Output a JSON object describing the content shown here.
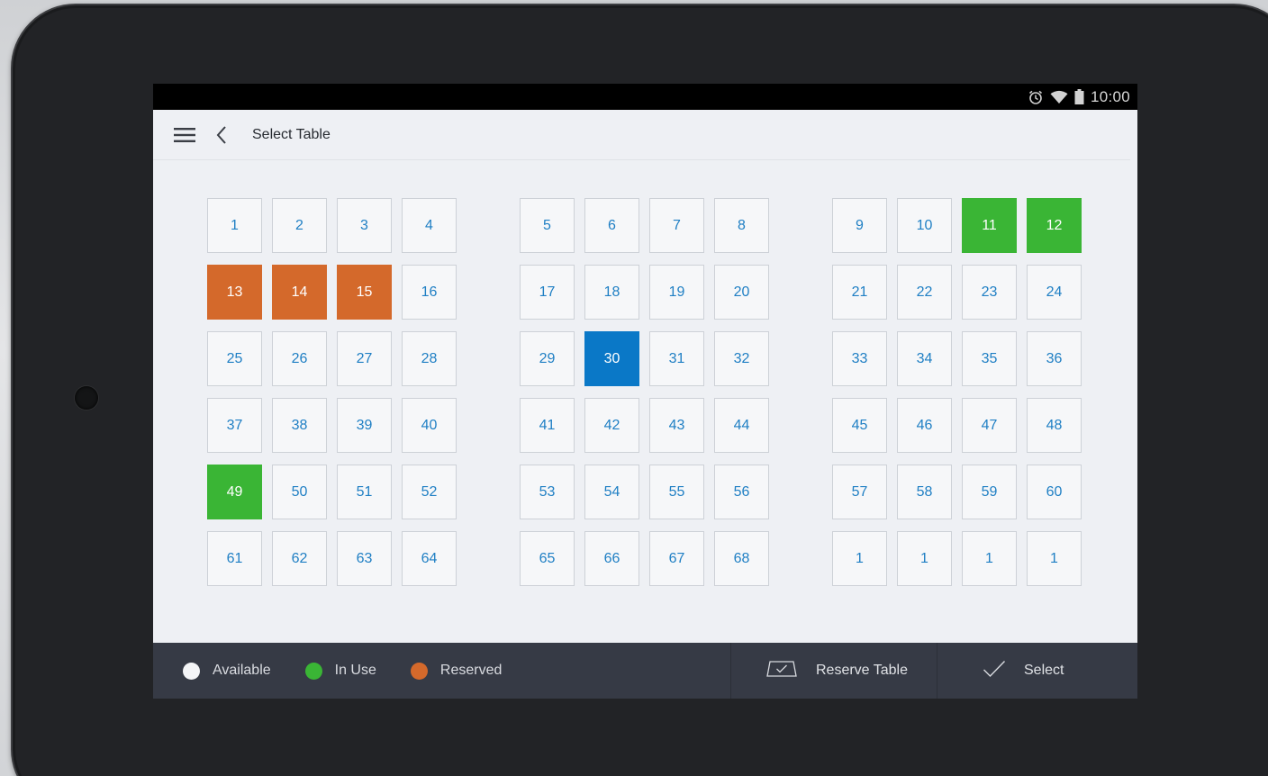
{
  "status_bar": {
    "time": "10:00",
    "icons": [
      "alarm-icon",
      "wifi-icon",
      "battery-icon"
    ]
  },
  "toolbar": {
    "title": "Select Table",
    "menu_icon": "hamburger-menu-icon",
    "back_icon": "chevron-left-icon"
  },
  "tables": {
    "groups": [
      [
        {
          "label": "1",
          "status": "available"
        },
        {
          "label": "2",
          "status": "available"
        },
        {
          "label": "3",
          "status": "available"
        },
        {
          "label": "4",
          "status": "available"
        },
        {
          "label": "13",
          "status": "reserved"
        },
        {
          "label": "14",
          "status": "reserved"
        },
        {
          "label": "15",
          "status": "reserved"
        },
        {
          "label": "16",
          "status": "available"
        },
        {
          "label": "25",
          "status": "available"
        },
        {
          "label": "26",
          "status": "available"
        },
        {
          "label": "27",
          "status": "available"
        },
        {
          "label": "28",
          "status": "available"
        },
        {
          "label": "37",
          "status": "available"
        },
        {
          "label": "38",
          "status": "available"
        },
        {
          "label": "39",
          "status": "available"
        },
        {
          "label": "40",
          "status": "available"
        },
        {
          "label": "49",
          "status": "inuse"
        },
        {
          "label": "50",
          "status": "available"
        },
        {
          "label": "51",
          "status": "available"
        },
        {
          "label": "52",
          "status": "available"
        },
        {
          "label": "61",
          "status": "available"
        },
        {
          "label": "62",
          "status": "available"
        },
        {
          "label": "63",
          "status": "available"
        },
        {
          "label": "64",
          "status": "available"
        }
      ],
      [
        {
          "label": "5",
          "status": "available"
        },
        {
          "label": "6",
          "status": "available"
        },
        {
          "label": "7",
          "status": "available"
        },
        {
          "label": "8",
          "status": "available"
        },
        {
          "label": "17",
          "status": "available"
        },
        {
          "label": "18",
          "status": "available"
        },
        {
          "label": "19",
          "status": "available"
        },
        {
          "label": "20",
          "status": "available"
        },
        {
          "label": "29",
          "status": "available"
        },
        {
          "label": "30",
          "status": "selected"
        },
        {
          "label": "31",
          "status": "available"
        },
        {
          "label": "32",
          "status": "available"
        },
        {
          "label": "41",
          "status": "available"
        },
        {
          "label": "42",
          "status": "available"
        },
        {
          "label": "43",
          "status": "available"
        },
        {
          "label": "44",
          "status": "available"
        },
        {
          "label": "53",
          "status": "available"
        },
        {
          "label": "54",
          "status": "available"
        },
        {
          "label": "55",
          "status": "available"
        },
        {
          "label": "56",
          "status": "available"
        },
        {
          "label": "65",
          "status": "available"
        },
        {
          "label": "66",
          "status": "available"
        },
        {
          "label": "67",
          "status": "available"
        },
        {
          "label": "68",
          "status": "available"
        }
      ],
      [
        {
          "label": "9",
          "status": "available"
        },
        {
          "label": "10",
          "status": "available"
        },
        {
          "label": "11",
          "status": "inuse"
        },
        {
          "label": "12",
          "status": "inuse"
        },
        {
          "label": "21",
          "status": "available"
        },
        {
          "label": "22",
          "status": "available"
        },
        {
          "label": "23",
          "status": "available"
        },
        {
          "label": "24",
          "status": "available"
        },
        {
          "label": "33",
          "status": "available"
        },
        {
          "label": "34",
          "status": "available"
        },
        {
          "label": "35",
          "status": "available"
        },
        {
          "label": "36",
          "status": "available"
        },
        {
          "label": "45",
          "status": "available"
        },
        {
          "label": "46",
          "status": "available"
        },
        {
          "label": "47",
          "status": "available"
        },
        {
          "label": "48",
          "status": "available"
        },
        {
          "label": "57",
          "status": "available"
        },
        {
          "label": "58",
          "status": "available"
        },
        {
          "label": "59",
          "status": "available"
        },
        {
          "label": "60",
          "status": "available"
        },
        {
          "label": "1",
          "status": "available"
        },
        {
          "label": "1",
          "status": "available"
        },
        {
          "label": "1",
          "status": "available"
        },
        {
          "label": "1",
          "status": "available"
        }
      ]
    ]
  },
  "legend": {
    "available": "Available",
    "in_use": "In Use",
    "reserved": "Reserved"
  },
  "actions": {
    "reserve_label": "Reserve Table",
    "reserve_icon": "reserve-table-icon",
    "select_label": "Select",
    "select_icon": "checkmark-icon"
  },
  "colors": {
    "available_text": "#1f7fc4",
    "in_use": "#3ab535",
    "reserved": "#d4692b",
    "selected": "#0a78c7",
    "bottom_bar": "#363a45"
  }
}
